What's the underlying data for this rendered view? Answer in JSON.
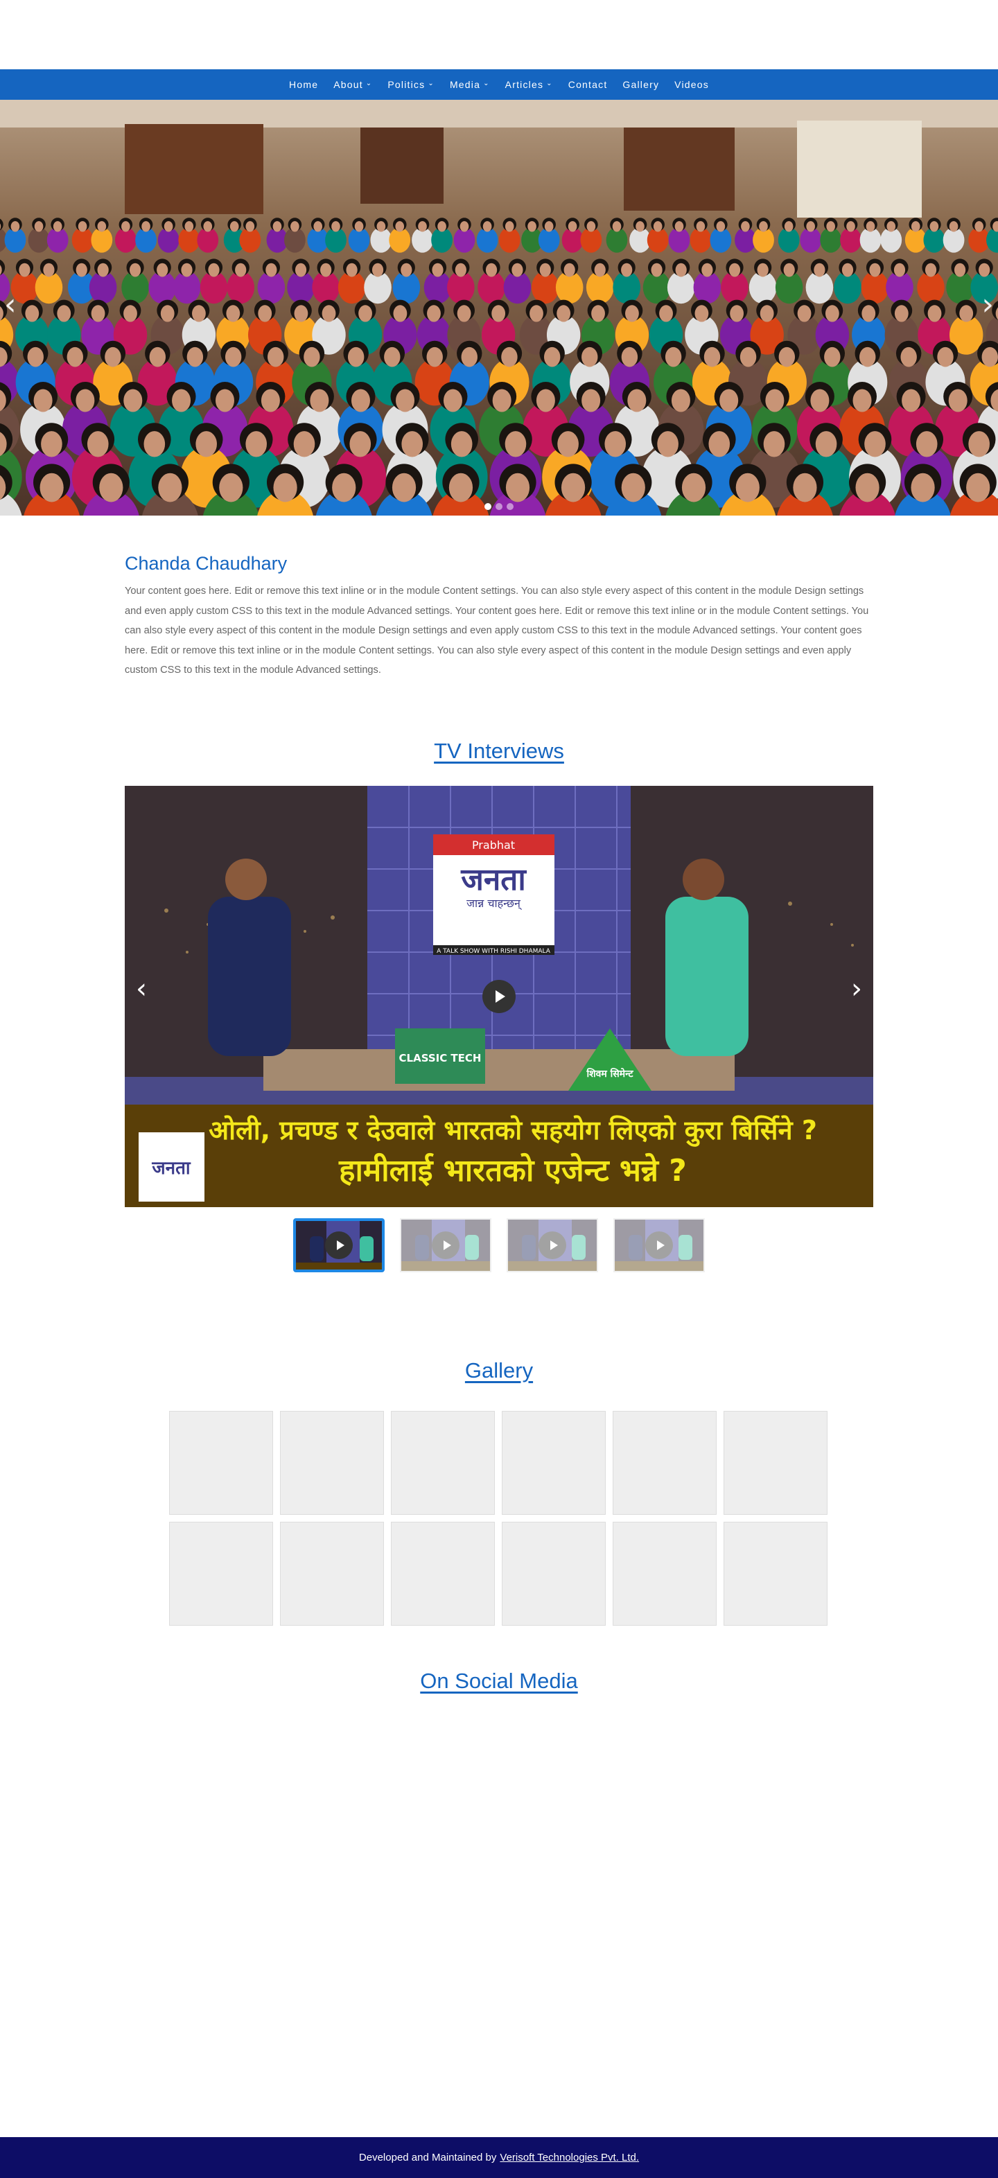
{
  "nav": {
    "items": [
      {
        "label": "Home",
        "dropdown": false
      },
      {
        "label": "About",
        "dropdown": true
      },
      {
        "label": "Politics",
        "dropdown": true
      },
      {
        "label": "Media",
        "dropdown": true
      },
      {
        "label": "Articles",
        "dropdown": true
      },
      {
        "label": "Contact",
        "dropdown": false
      },
      {
        "label": "Gallery",
        "dropdown": false
      },
      {
        "label": "Videos",
        "dropdown": false
      }
    ],
    "chevron": "⌄"
  },
  "hero": {
    "slides_count": 3,
    "active_slide": 1,
    "prev_glyph": "‹",
    "next_glyph": "›"
  },
  "about": {
    "title": "Chanda Chaudhary",
    "body": "Your content goes here. Edit or remove this text inline or in the module Content settings. You can also style every aspect of this content in the module Design settings and even apply custom CSS to this text in the module Advanced settings. Your content goes here. Edit or remove this text inline or in the module Content settings. You can also style every aspect of this content in the module Design settings and even apply custom CSS to this text in the module Advanced settings. Your content goes here. Edit or remove this text inline or in the module Content settings. You can also style every aspect of this content in the module Design settings and even apply custom CSS to this text in the module Advanced settings."
  },
  "tv": {
    "title": "TV Interviews",
    "video": {
      "show_logo": "Prabhat",
      "show_name": "जनता",
      "show_subtitle": "जान्न चाहन्छन्",
      "show_tagline": "A TALK SHOW WITH RISHI DHAMALA",
      "sponsor_1": "CLASSIC TECH",
      "sponsor_2": "शिवम सिमेन्ट",
      "caption_line_1": "ओली, प्रचण्ड र देउवाले भारतको सहयोग लिएको कुरा बिर्सिने ?",
      "caption_line_2": "हामीलाई भारतको एजेन्ट भन्ने ?"
    },
    "prev_glyph": "‹",
    "next_glyph": "›",
    "thumbs_count": 4,
    "active_thumb": 0
  },
  "gallery": {
    "title": "Gallery",
    "tiles_count": 12
  },
  "social": {
    "title": "On Social Media"
  },
  "footer": {
    "text": "Developed and Maintained by",
    "link": "Verisoft Technologies Pvt. Ltd."
  },
  "colors": {
    "nav_bg": "#1565c0",
    "accent": "#1565c0",
    "footer_bg": "#0d0d66",
    "active_thumb_border": "#1e88e5"
  }
}
